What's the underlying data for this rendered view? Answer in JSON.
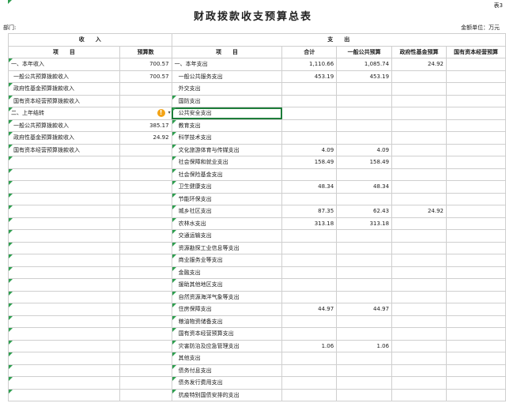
{
  "sheet": {
    "title": "财政拨款收支预算总表",
    "table_tag": "表3",
    "department_label": "部门:",
    "unit_label": "金额单位：万元"
  },
  "header": {
    "income": "收　　入",
    "expense": "支　　出",
    "item": "项　　目",
    "budget": "预算数",
    "item2": "项　　目",
    "total": "合计",
    "general": "一般公共预算",
    "fund": "政府性基金预算",
    "capital": "国有资本经营预算"
  },
  "income_rows": [
    {
      "label": "一、本年收入",
      "value": "700.57"
    },
    {
      "label": "一般公共预算拨款收入",
      "value": "700.57"
    },
    {
      "label": "政府性基金预算拨款收入",
      "value": ""
    },
    {
      "label": "国有资本经营预算拨款收入",
      "value": ""
    },
    {
      "label": "二、上年结转",
      "value": ""
    },
    {
      "label": "一般公共预算拨款收入",
      "value": "385.17"
    },
    {
      "label": "政府性基金预算拨款收入",
      "value": "24.92"
    },
    {
      "label": "国有资本经营预算拨款收入",
      "value": ""
    }
  ],
  "expense_rows": [
    {
      "label": "一、本年支出",
      "total": "1,110.66",
      "general": "1,085.74",
      "fund": "24.92",
      "capital": ""
    },
    {
      "label": "一般公共服务支出",
      "total": "453.19",
      "general": "453.19",
      "fund": "",
      "capital": ""
    },
    {
      "label": "外交支出",
      "total": "",
      "general": "",
      "fund": "",
      "capital": ""
    },
    {
      "label": "国防支出",
      "total": "",
      "general": "",
      "fund": "",
      "capital": ""
    },
    {
      "label": "公共安全支出",
      "total": "",
      "general": "",
      "fund": "",
      "capital": ""
    },
    {
      "label": "教育支出",
      "total": "",
      "general": "",
      "fund": "",
      "capital": ""
    },
    {
      "label": "科学技术支出",
      "total": "",
      "general": "",
      "fund": "",
      "capital": ""
    },
    {
      "label": "文化旅游体育与传媒支出",
      "total": "4.09",
      "general": "4.09",
      "fund": "",
      "capital": ""
    },
    {
      "label": "社会保障和就业支出",
      "total": "158.49",
      "general": "158.49",
      "fund": "",
      "capital": ""
    },
    {
      "label": "社会保险基金支出",
      "total": "",
      "general": "",
      "fund": "",
      "capital": ""
    },
    {
      "label": "卫生健康支出",
      "total": "48.34",
      "general": "48.34",
      "fund": "",
      "capital": ""
    },
    {
      "label": "节能环保支出",
      "total": "",
      "general": "",
      "fund": "",
      "capital": ""
    },
    {
      "label": "城乡社区支出",
      "total": "87.35",
      "general": "62.43",
      "fund": "24.92",
      "capital": ""
    },
    {
      "label": "农林水支出",
      "total": "313.18",
      "general": "313.18",
      "fund": "",
      "capital": ""
    },
    {
      "label": "交通运输支出",
      "total": "",
      "general": "",
      "fund": "",
      "capital": ""
    },
    {
      "label": "资源勘探工业信息等支出",
      "total": "",
      "general": "",
      "fund": "",
      "capital": ""
    },
    {
      "label": "商业服务业等支出",
      "total": "",
      "general": "",
      "fund": "",
      "capital": ""
    },
    {
      "label": "金融支出",
      "total": "",
      "general": "",
      "fund": "",
      "capital": ""
    },
    {
      "label": "援助其他地区支出",
      "total": "",
      "general": "",
      "fund": "",
      "capital": ""
    },
    {
      "label": "自然资源海洋气象等支出",
      "total": "",
      "general": "",
      "fund": "",
      "capital": ""
    },
    {
      "label": "住房保障支出",
      "total": "44.97",
      "general": "44.97",
      "fund": "",
      "capital": ""
    },
    {
      "label": "粮油物资储备支出",
      "total": "",
      "general": "",
      "fund": "",
      "capital": ""
    },
    {
      "label": "国有资本经营预算支出",
      "total": "",
      "general": "",
      "fund": "",
      "capital": ""
    },
    {
      "label": "灾害防治及应急管理支出",
      "total": "1.06",
      "general": "1.06",
      "fund": "",
      "capital": ""
    },
    {
      "label": "其他支出",
      "total": "",
      "general": "",
      "fund": "",
      "capital": ""
    },
    {
      "label": "债务付息支出",
      "total": "",
      "general": "",
      "fund": "",
      "capital": ""
    },
    {
      "label": "债务发行费用支出",
      "total": "",
      "general": "",
      "fund": "",
      "capital": ""
    },
    {
      "label": "抗疫特别国债安排的支出",
      "total": "",
      "general": "",
      "fund": "",
      "capital": ""
    }
  ],
  "colors": {
    "accent": "#1e7d3a",
    "marker": "#2e9e4f",
    "warning": "#f3a316"
  },
  "icons": {
    "warning": "warning-icon",
    "dropdown": "dropdown-arrow-icon",
    "comment": "comment-marker-icon"
  }
}
